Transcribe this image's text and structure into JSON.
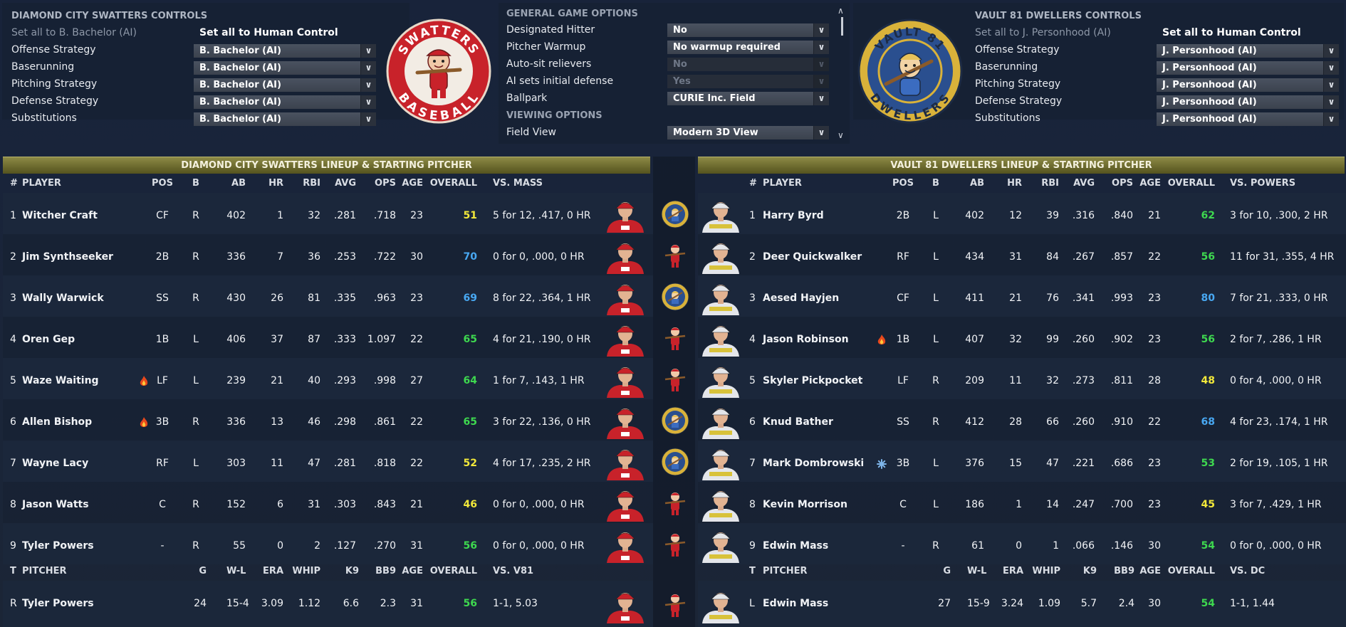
{
  "home_controls": {
    "title": "DIAMOND CITY SWATTERS CONTROLS",
    "set_all_ai": "Set all to B. Bachelor (AI)",
    "set_all_human": "Set all to Human Control",
    "rows": [
      {
        "label": "Offense Strategy",
        "value": "B. Bachelor (AI)"
      },
      {
        "label": "Baserunning",
        "value": "B. Bachelor (AI)"
      },
      {
        "label": "Pitching Strategy",
        "value": "B. Bachelor (AI)"
      },
      {
        "label": "Defense Strategy",
        "value": "B. Bachelor (AI)"
      },
      {
        "label": "Substitutions",
        "value": "B. Bachelor (AI)"
      }
    ],
    "logo_top": "SWATTERS",
    "logo_bottom": "BASEBALL"
  },
  "away_controls": {
    "title": "VAULT 81 DWELLERS CONTROLS",
    "set_all_ai": "Set all to J. Personhood (AI)",
    "set_all_human": "Set all to Human Control",
    "rows": [
      {
        "label": "Offense Strategy",
        "value": "J. Personhood (AI)"
      },
      {
        "label": "Baserunning",
        "value": "J. Personhood (AI)"
      },
      {
        "label": "Pitching Strategy",
        "value": "J. Personhood (AI)"
      },
      {
        "label": "Defense Strategy",
        "value": "J. Personhood (AI)"
      },
      {
        "label": "Substitutions",
        "value": "J. Personhood (AI)"
      }
    ],
    "logo_top": "VAULT 81",
    "logo_bottom": "DWELLERS"
  },
  "game_options": {
    "header": "GENERAL GAME OPTIONS",
    "rows": [
      {
        "label": "Designated Hitter",
        "value": "No",
        "disabled": false
      },
      {
        "label": "Pitcher Warmup",
        "value": "No warmup required",
        "disabled": false
      },
      {
        "label": "Auto-sit relievers",
        "value": "No",
        "disabled": true
      },
      {
        "label": "AI sets initial defense",
        "value": "Yes",
        "disabled": true
      },
      {
        "label": "Ballpark",
        "value": "CURIE Inc. Field",
        "disabled": false
      }
    ],
    "viewing_header": "VIEWING OPTIONS",
    "field_view_label": "Field View",
    "field_view_value": "Modern 3D View"
  },
  "chevron": "∨",
  "scroll_up": "∧",
  "scroll_down": "∨",
  "home_lineup": {
    "banner": "DIAMOND CITY SWATTERS LINEUP & STARTING PITCHER",
    "headers": {
      "num": "#",
      "player": "PLAYER",
      "pos": "POS",
      "b": "B",
      "ab": "AB",
      "hr": "HR",
      "rbi": "RBI",
      "avg": "AVG",
      "ops": "OPS",
      "age": "AGE",
      "overall": "OVERALL",
      "vs": "VS. MASS"
    },
    "batters": [
      {
        "num": "1",
        "name": "Witcher Craft",
        "hot": false,
        "pos": "CF",
        "b": "R",
        "ab": "402",
        "hr": "1",
        "rbi": "32",
        "avg": ".281",
        "ops": ".718",
        "age": "23",
        "overall": "51",
        "ovr_color": "yellow",
        "vs": "5 for 12, .417, 0 HR",
        "mini": "vault"
      },
      {
        "num": "2",
        "name": "Jim Synthseeker",
        "hot": false,
        "pos": "2B",
        "b": "R",
        "ab": "336",
        "hr": "7",
        "rbi": "36",
        "avg": ".253",
        "ops": ".722",
        "age": "30",
        "overall": "70",
        "ovr_color": "blue",
        "vs": "0 for 0, .000, 0 HR",
        "mini": "swatter"
      },
      {
        "num": "3",
        "name": "Wally Warwick",
        "hot": false,
        "pos": "SS",
        "b": "R",
        "ab": "430",
        "hr": "26",
        "rbi": "81",
        "avg": ".335",
        "ops": ".963",
        "age": "23",
        "overall": "69",
        "ovr_color": "blue",
        "vs": "8 for 22, .364, 1 HR",
        "mini": "vault"
      },
      {
        "num": "4",
        "name": "Oren Gep",
        "hot": false,
        "pos": "1B",
        "b": "L",
        "ab": "406",
        "hr": "37",
        "rbi": "87",
        "avg": ".333",
        "ops": "1.097",
        "age": "22",
        "overall": "65",
        "ovr_color": "green",
        "vs": "4 for 21, .190, 0 HR",
        "mini": "swatter"
      },
      {
        "num": "5",
        "name": "Waze Waiting",
        "hot": true,
        "pos": "LF",
        "b": "L",
        "ab": "239",
        "hr": "21",
        "rbi": "40",
        "avg": ".293",
        "ops": ".998",
        "age": "27",
        "overall": "64",
        "ovr_color": "green",
        "vs": "1 for 7, .143, 1 HR",
        "mini": "swatter"
      },
      {
        "num": "6",
        "name": "Allen Bishop",
        "hot": true,
        "pos": "3B",
        "b": "R",
        "ab": "336",
        "hr": "13",
        "rbi": "46",
        "avg": ".298",
        "ops": ".861",
        "age": "22",
        "overall": "65",
        "ovr_color": "green",
        "vs": "3 for 22, .136, 0 HR",
        "mini": "vault"
      },
      {
        "num": "7",
        "name": "Wayne Lacy",
        "hot": false,
        "pos": "RF",
        "b": "L",
        "ab": "303",
        "hr": "11",
        "rbi": "47",
        "avg": ".281",
        "ops": ".818",
        "age": "22",
        "overall": "52",
        "ovr_color": "yellow",
        "vs": "4 for 17, .235, 2 HR",
        "mini": "vault"
      },
      {
        "num": "8",
        "name": "Jason Watts",
        "hot": false,
        "pos": "C",
        "b": "R",
        "ab": "152",
        "hr": "6",
        "rbi": "31",
        "avg": ".303",
        "ops": ".843",
        "age": "21",
        "overall": "46",
        "ovr_color": "yellow",
        "vs": "0 for 0, .000, 0 HR",
        "mini": "swatter"
      },
      {
        "num": "9",
        "name": "Tyler Powers",
        "hot": false,
        "pos": "-",
        "b": "R",
        "ab": "55",
        "hr": "0",
        "rbi": "2",
        "avg": ".127",
        "ops": ".270",
        "age": "31",
        "overall": "56",
        "ovr_color": "green",
        "vs": "0 for 0, .000, 0 HR",
        "mini": "swatter"
      }
    ],
    "pitcher_headers": {
      "t": "T",
      "pitcher": "PITCHER",
      "g": "G",
      "wl": "W-L",
      "era": "ERA",
      "whip": "WHIP",
      "k9": "K9",
      "bb9": "BB9",
      "age": "AGE",
      "overall": "OVERALL",
      "vs": "VS. V81"
    },
    "pitcher": {
      "t": "R",
      "name": "Tyler Powers",
      "g": "24",
      "wl": "15-4",
      "era": "3.09",
      "whip": "1.12",
      "k9": "6.6",
      "bb9": "2.3",
      "age": "31",
      "overall": "56",
      "vs": "1-1, 5.03"
    }
  },
  "away_lineup": {
    "banner": "VAULT 81 DWELLERS LINEUP & STARTING PITCHER",
    "headers": {
      "num": "#",
      "player": "PLAYER",
      "pos": "POS",
      "b": "B",
      "ab": "AB",
      "hr": "HR",
      "rbi": "RBI",
      "avg": "AVG",
      "ops": "OPS",
      "age": "AGE",
      "overall": "OVERALL",
      "vs": "VS. POWERS"
    },
    "batters": [
      {
        "num": "1",
        "name": "Harry Byrd",
        "badge": "",
        "pos": "2B",
        "b": "L",
        "ab": "402",
        "hr": "12",
        "rbi": "39",
        "avg": ".316",
        "ops": ".840",
        "age": "21",
        "overall": "62",
        "ovr_color": "green",
        "vs": "3 for 10, .300, 2 HR"
      },
      {
        "num": "2",
        "name": "Deer Quickwalker",
        "badge": "",
        "pos": "RF",
        "b": "L",
        "ab": "434",
        "hr": "31",
        "rbi": "84",
        "avg": ".267",
        "ops": ".857",
        "age": "22",
        "overall": "56",
        "ovr_color": "green",
        "vs": "11 for 31, .355, 4 HR"
      },
      {
        "num": "3",
        "name": "Aesed Hayjen",
        "badge": "",
        "pos": "CF",
        "b": "L",
        "ab": "411",
        "hr": "21",
        "rbi": "76",
        "avg": ".341",
        "ops": ".993",
        "age": "23",
        "overall": "80",
        "ovr_color": "blue",
        "vs": "7 for 21, .333, 0 HR"
      },
      {
        "num": "4",
        "name": "Jason Robinson",
        "badge": "hot",
        "pos": "1B",
        "b": "L",
        "ab": "407",
        "hr": "32",
        "rbi": "99",
        "avg": ".260",
        "ops": ".902",
        "age": "23",
        "overall": "56",
        "ovr_color": "green",
        "vs": "2 for 7, .286, 1 HR"
      },
      {
        "num": "5",
        "name": "Skyler Pickpocket",
        "badge": "",
        "pos": "LF",
        "b": "R",
        "ab": "209",
        "hr": "11",
        "rbi": "32",
        "avg": ".273",
        "ops": ".811",
        "age": "28",
        "overall": "48",
        "ovr_color": "yellow",
        "vs": "0 for 4, .000, 0 HR"
      },
      {
        "num": "6",
        "name": "Knud Bather",
        "badge": "",
        "pos": "SS",
        "b": "R",
        "ab": "412",
        "hr": "28",
        "rbi": "66",
        "avg": ".260",
        "ops": ".910",
        "age": "22",
        "overall": "68",
        "ovr_color": "blue",
        "vs": "4 for 23, .174, 1 HR"
      },
      {
        "num": "7",
        "name": "Mark Dombrowski",
        "badge": "cold",
        "pos": "3B",
        "b": "L",
        "ab": "376",
        "hr": "15",
        "rbi": "47",
        "avg": ".221",
        "ops": ".686",
        "age": "23",
        "overall": "53",
        "ovr_color": "green",
        "vs": "2 for 19, .105, 1 HR"
      },
      {
        "num": "8",
        "name": "Kevin Morrison",
        "badge": "",
        "pos": "C",
        "b": "L",
        "ab": "186",
        "hr": "1",
        "rbi": "14",
        "avg": ".247",
        "ops": ".700",
        "age": "23",
        "overall": "45",
        "ovr_color": "yellow",
        "vs": "3 for 7, .429, 1 HR"
      },
      {
        "num": "9",
        "name": "Edwin Mass",
        "badge": "",
        "pos": "-",
        "b": "R",
        "ab": "61",
        "hr": "0",
        "rbi": "1",
        "avg": ".066",
        "ops": ".146",
        "age": "30",
        "overall": "54",
        "ovr_color": "green",
        "vs": "0 for 0, .000, 0 HR"
      }
    ],
    "pitcher_headers": {
      "t": "T",
      "pitcher": "PITCHER",
      "g": "G",
      "wl": "W-L",
      "era": "ERA",
      "whip": "WHIP",
      "k9": "K9",
      "bb9": "BB9",
      "age": "AGE",
      "overall": "OVERALL",
      "vs": "VS. DC"
    },
    "pitcher": {
      "t": "L",
      "name": "Edwin Mass",
      "g": "27",
      "wl": "15-9",
      "era": "3.24",
      "whip": "1.09",
      "k9": "5.7",
      "bb9": "2.4",
      "age": "30",
      "overall": "54",
      "vs": "1-1, 1.44"
    }
  },
  "pitcher_mini": "swatter",
  "colors": {
    "green": "#3ed84f",
    "yellow": "#f2e83a",
    "blue": "#48a8f2",
    "banner": "#7b7838",
    "swatters_red": "#c8222a",
    "vault_blue": "#2a4f8f",
    "vault_gold": "#d9b23a"
  }
}
